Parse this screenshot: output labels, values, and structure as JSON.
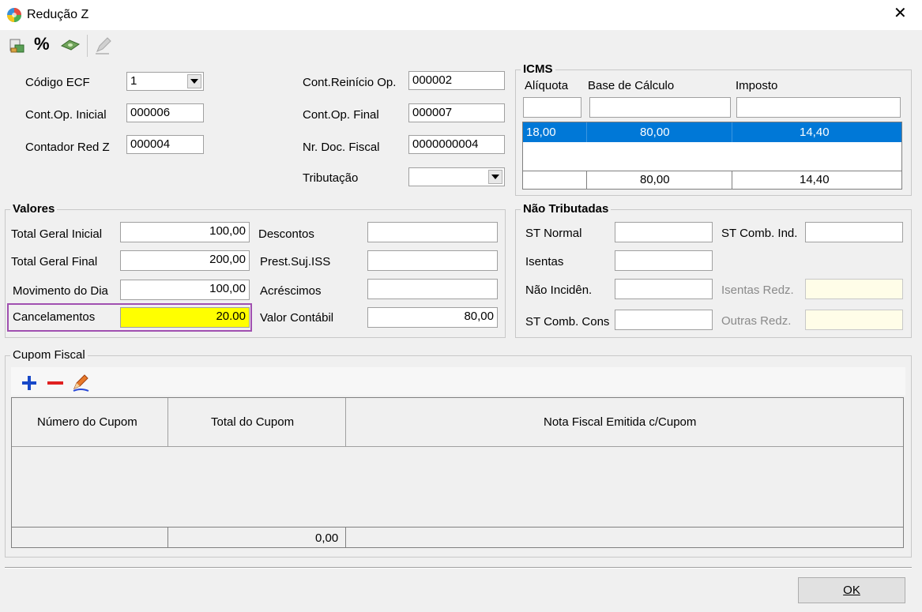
{
  "window": {
    "title": "Redução Z",
    "close_glyph": "✕"
  },
  "toolbar": {
    "percent_label": "%"
  },
  "fields": {
    "codigo_ecf": {
      "label": "Código ECF",
      "value": "1"
    },
    "cont_op_inicial": {
      "label": "Cont.Op. Inicial",
      "value": "000006"
    },
    "contador_red_z": {
      "label": "Contador Red Z",
      "value": "000004"
    },
    "cont_reinicio": {
      "label": "Cont.Reinício Op.",
      "value": "000002"
    },
    "cont_op_final": {
      "label": "Cont.Op. Final",
      "value": "000007"
    },
    "nr_doc_fiscal": {
      "label": "Nr. Doc. Fiscal",
      "value": "0000000004"
    },
    "tributacao": {
      "label": "Tributação",
      "value": ""
    }
  },
  "icms": {
    "title": "ICMS",
    "col_aliquota": "Alíquota",
    "col_base": "Base de Cálculo",
    "col_imposto": "Imposto",
    "row": {
      "aliquota": "18,00",
      "base": "80,00",
      "imposto": "14,40"
    },
    "total": {
      "base": "80,00",
      "imposto": "14,40"
    },
    "selected_color": "#0078d7"
  },
  "valores": {
    "title": "Valores",
    "total_geral_inicial": {
      "label": "Total Geral Inicial",
      "value": "100,00"
    },
    "total_geral_final": {
      "label": "Total Geral Final",
      "value": "200,00"
    },
    "movimento_do_dia": {
      "label": "Movimento do Dia",
      "value": "100,00"
    },
    "cancelamentos": {
      "label": "Cancelamentos",
      "value": "20.00",
      "highlight": "#ffff00",
      "border": "#a050b0"
    },
    "descontos": {
      "label": "Descontos",
      "value": ""
    },
    "prest_suj_iss": {
      "label": "Prest.Suj.ISS",
      "value": ""
    },
    "acrescimos": {
      "label": "Acréscimos",
      "value": ""
    },
    "valor_contabil": {
      "label": "Valor Contábil",
      "value": "80,00"
    }
  },
  "nao_tributadas": {
    "title": "Não Tributadas",
    "st_normal": {
      "label": "ST Normal",
      "value": ""
    },
    "st_comb_ind": {
      "label": "ST Comb. Ind.",
      "value": ""
    },
    "isentas": {
      "label": "Isentas",
      "value": ""
    },
    "nao_incid": {
      "label": "Não Incidên.",
      "value": ""
    },
    "isentas_redz": {
      "label": "Isentas Redz.",
      "value": ""
    },
    "st_comb_cons": {
      "label": "ST Comb. Cons",
      "value": ""
    },
    "outras_redz": {
      "label": "Outras Redz.",
      "value": ""
    }
  },
  "cupom": {
    "title": "Cupom Fiscal",
    "columns": [
      "Número do Cupom",
      "Total do Cupom",
      "Nota Fiscal Emitida c/Cupom"
    ],
    "total": "0,00"
  },
  "footer": {
    "ok_label": "OK"
  }
}
